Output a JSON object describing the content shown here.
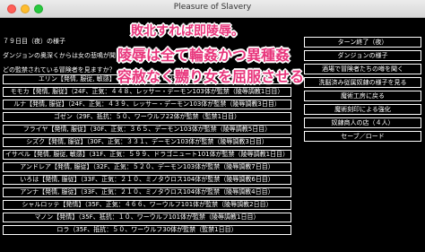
{
  "window": {
    "title": "Pleasure of Slavery"
  },
  "messages": [
    "７９日目（夜）の様子",
    "ダンジョンの奥深くからは女の悲鳴が聞こえてくる……",
    "どの監禁されている冒険者を見ますか？"
  ],
  "slave_rows": [
    "エリン【発情, 服従, 敏感】（24F、正気：２６３、ゴブリン１１２体が監禁）",
    "モモカ【発情, 服従】（24F、正気：４４８、レッサー・デーモン103体が監禁（陵辱調教1日目）",
    "ルナ【発情, 服従】（24F、正気：４３９、レッサー・デーモン103体が監禁（陵辱調教3日目）",
    "ゴゼン（29F、抵抗：５０、ワーウルフ22体が監禁（監禁1日目）",
    "フライヤ【発情, 服従】（30F、正気：３６５、デーモン103体が監禁（陵辱調教5日目）",
    "シズク【発情, 服従】（30F、正気：３３１、デーモン103体が監禁（陵辱調教3日目）",
    "イサベル【発情, 服従, 敏感】（31F、正気：５９９、ドラゴニュート101体が監禁（陵辱調教1日目）",
    "アンドレア【発情, 服従】（32F、正気：５２０、デーモン103体が監禁（陵辱調教7日目）",
    "いろは【発情, 服従】（33F、正気：２１０、ミノタウロス104体が監禁（陵辱調教6日目）",
    "アンナ【発情, 服従】（33F、正気：２１０、ミノタウロス104体が監禁（陵辱調教4日目）",
    "シャルロッテ【発情】（35F、正気：４６６、ワーウルフ101体が監禁（陵辱調教2日目）",
    "マノン【発情】（35F、抵抗：１０、ワーウルフ101体が監禁（陵辱調教1日目）",
    "ロラ（35F、抵抗：５０、ワーウルフ30体が監禁（監禁1日目）"
  ],
  "menu_buttons": [
    "ターン終了（夜）",
    "ダンジョンの様子",
    "酒場で冒険者たちの噂を聞く",
    "洗脳済み従属奴隷の様子を見る",
    "魔術工房に戻る",
    "魔術刻印による強化",
    "奴隷商人の店（４人）",
    "セーブ／ロード"
  ],
  "overlay_captions": [
    "敗北すれば即陵辱。",
    "陵辱は全て輪姦かつ異種姦",
    "容赦なく嬲り女を屈服させる"
  ],
  "colors": {
    "overlay_text": "#e8367c",
    "overlay_outline": "#ffffff",
    "background": "#000000",
    "foreground": "#ffffff"
  }
}
